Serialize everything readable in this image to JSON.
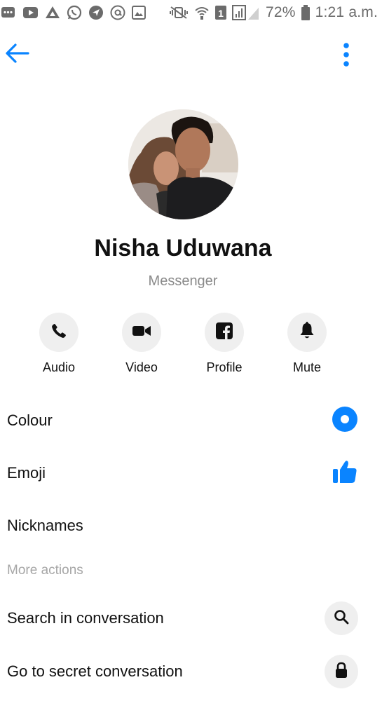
{
  "status_bar": {
    "battery": "72%",
    "time": "1:21 a.m.",
    "sim": "1",
    "left_icons": [
      "message-icon",
      "youtube-icon",
      "drive-icon",
      "whatsapp-icon",
      "navigation-icon",
      "at-icon",
      "gallery-icon"
    ],
    "right_icons": [
      "mute-vibrate-icon",
      "wifi-icon",
      "sim-icon",
      "signal-icon",
      "battery-icon"
    ]
  },
  "app_bar": {
    "back_icon": "arrow-left-icon",
    "more_icon": "more-vertical-icon"
  },
  "profile": {
    "name": "Nisha Uduwana",
    "subtitle": "Messenger"
  },
  "actions": [
    {
      "label": "Audio",
      "icon": "phone-icon"
    },
    {
      "label": "Video",
      "icon": "video-camera-icon"
    },
    {
      "label": "Profile",
      "icon": "facebook-icon"
    },
    {
      "label": "Mute",
      "icon": "bell-icon"
    }
  ],
  "settings": {
    "colour_label": "Colour",
    "emoji_label": "Emoji",
    "nicknames_label": "Nicknames",
    "more_actions_header": "More actions",
    "search_label": "Search in conversation",
    "secret_label": "Go to secret conversation"
  },
  "colors": {
    "accent": "#0a84ff",
    "icon_gray": "#6b6b6b",
    "circle_bg": "#efefef"
  }
}
